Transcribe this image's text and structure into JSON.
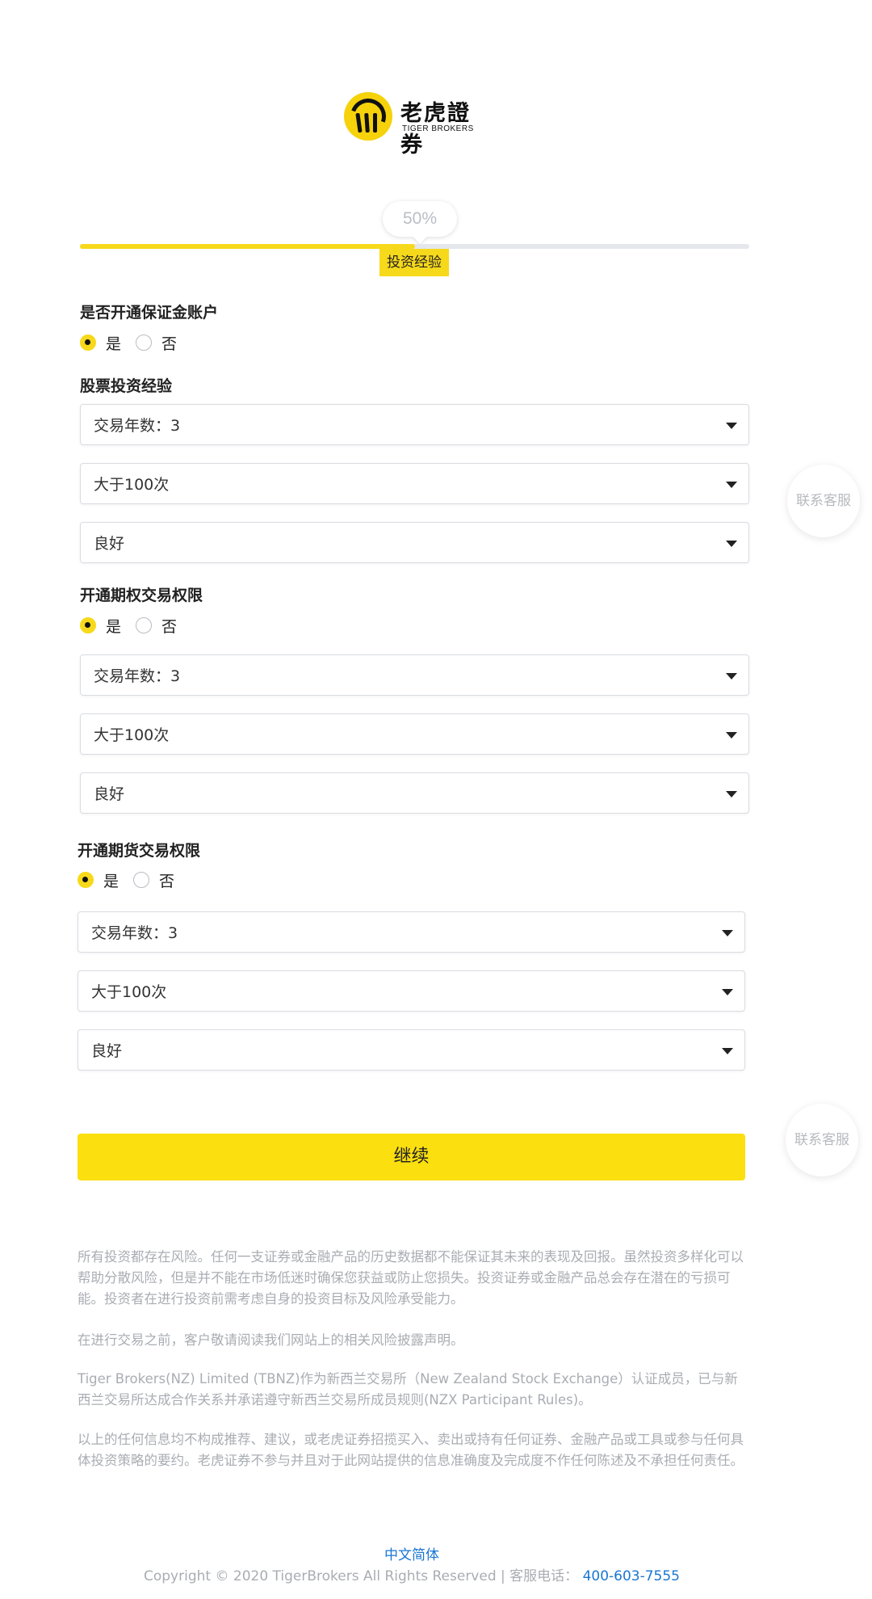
{
  "logo": {
    "cn": "老虎證券",
    "en": "TIGER BROKERS"
  },
  "progress": {
    "percent_label": "50%",
    "percent": 50,
    "step_label": "投资经验"
  },
  "margin_account": {
    "title": "是否开通保证金账户",
    "yes": "是",
    "no": "否",
    "selected": "yes"
  },
  "stock_experience": {
    "title": "股票投资经验",
    "selects": [
      "交易年数：3",
      "大于100次",
      "良好"
    ]
  },
  "options_permission": {
    "title": "开通期权交易权限",
    "yes": "是",
    "no": "否",
    "selected": "yes",
    "selects": [
      "交易年数：3",
      "大于100次",
      "良好"
    ]
  },
  "futures_permission": {
    "title": "开通期货交易权限",
    "yes": "是",
    "no": "否",
    "selected": "yes",
    "selects": [
      "交易年数：3",
      "大于100次",
      "良好"
    ]
  },
  "continue_label": "继续",
  "customer_service_label": "联系客服",
  "disclaimer": [
    "所有投资都存在风险。任何一支证券或金融产品的历史数据都不能保证其未来的表现及回报。虽然投资多样化可以帮助分散风险，但是并不能在市场低迷时确保您获益或防止您损失。投资证券或金融产品总会存在潜在的亏损可能。投资者在进行投资前需考虑自身的投资目标及风险承受能力。",
    "在进行交易之前，客户敬请阅读我们网站上的相关风险披露声明。",
    "Tiger Brokers(NZ) Limited (TBNZ)作为新西兰交易所（New Zealand Stock Exchange）认证成员，已与新西兰交易所达成合作关系并承诺遵守新西兰交易所成员规则(NZX Participant Rules)。",
    "以上的任何信息均不构成推荐、建议，或老虎证券招揽买入、卖出或持有任何证券、金融产品或工具或参与任何具体投资策略的要约。老虎证券不参与并且对于此网站提供的信息准确度及完成度不作任何陈述及不承担任何责任。"
  ],
  "footer": {
    "language": "中文简体",
    "copyright": "Copyright © 2020 TigerBrokers All Rights Reserved | 客服电话：",
    "phone": "400-603-7555"
  },
  "colors": {
    "accent": "#f7d91b",
    "link": "#1976d2",
    "muted": "#a9adb3"
  }
}
